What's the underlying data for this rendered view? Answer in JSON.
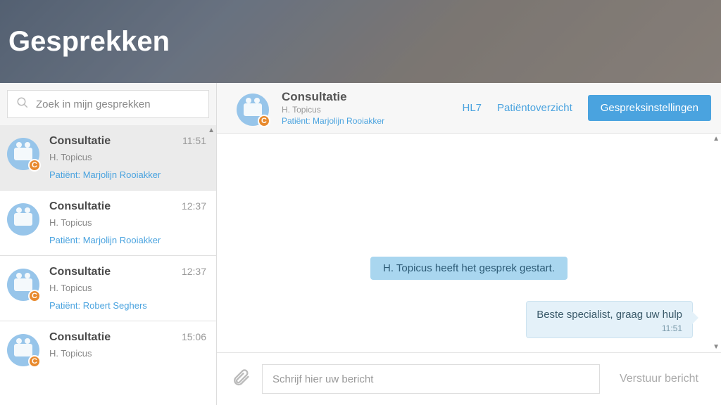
{
  "header": {
    "title": "Gesprekken"
  },
  "search": {
    "placeholder": "Zoek in mijn gesprekken"
  },
  "conversations": [
    {
      "title": "Consultatie",
      "time": "11:51",
      "sub": "H. Topicus",
      "patient_label": "Patiënt:",
      "patient_name": "Marjolijn Rooiakker",
      "badge": "C",
      "selected": true
    },
    {
      "title": "Consultatie",
      "time": "12:37",
      "sub": "H. Topicus",
      "patient_label": "Patiënt:",
      "patient_name": "Marjolijn Rooiakker",
      "badge": "",
      "selected": false
    },
    {
      "title": "Consultatie",
      "time": "12:37",
      "sub": "H. Topicus",
      "patient_label": "Patiënt:",
      "patient_name": "Robert Seghers",
      "badge": "C",
      "selected": false
    },
    {
      "title": "Consultatie",
      "time": "15:06",
      "sub": "H. Topicus",
      "patient_label": "",
      "patient_name": "",
      "badge": "C",
      "selected": false
    }
  ],
  "chat": {
    "header": {
      "title": "Consultatie",
      "sub": "H. Topicus",
      "patient_label": "Patiënt:",
      "patient_name": "Marjolijn Rooiakker",
      "link_hl7": "HL7",
      "link_overview": "Patiëntoverzicht",
      "btn_settings": "Gespreksinstellingen",
      "badge": "C"
    },
    "messages": {
      "system": "H. Topicus heeft het gesprek gestart.",
      "user_text": "Beste specialist, graag uw hulp",
      "user_time": "11:51"
    },
    "compose": {
      "placeholder": "Schrijf hier uw bericht",
      "send": "Verstuur bericht"
    }
  }
}
